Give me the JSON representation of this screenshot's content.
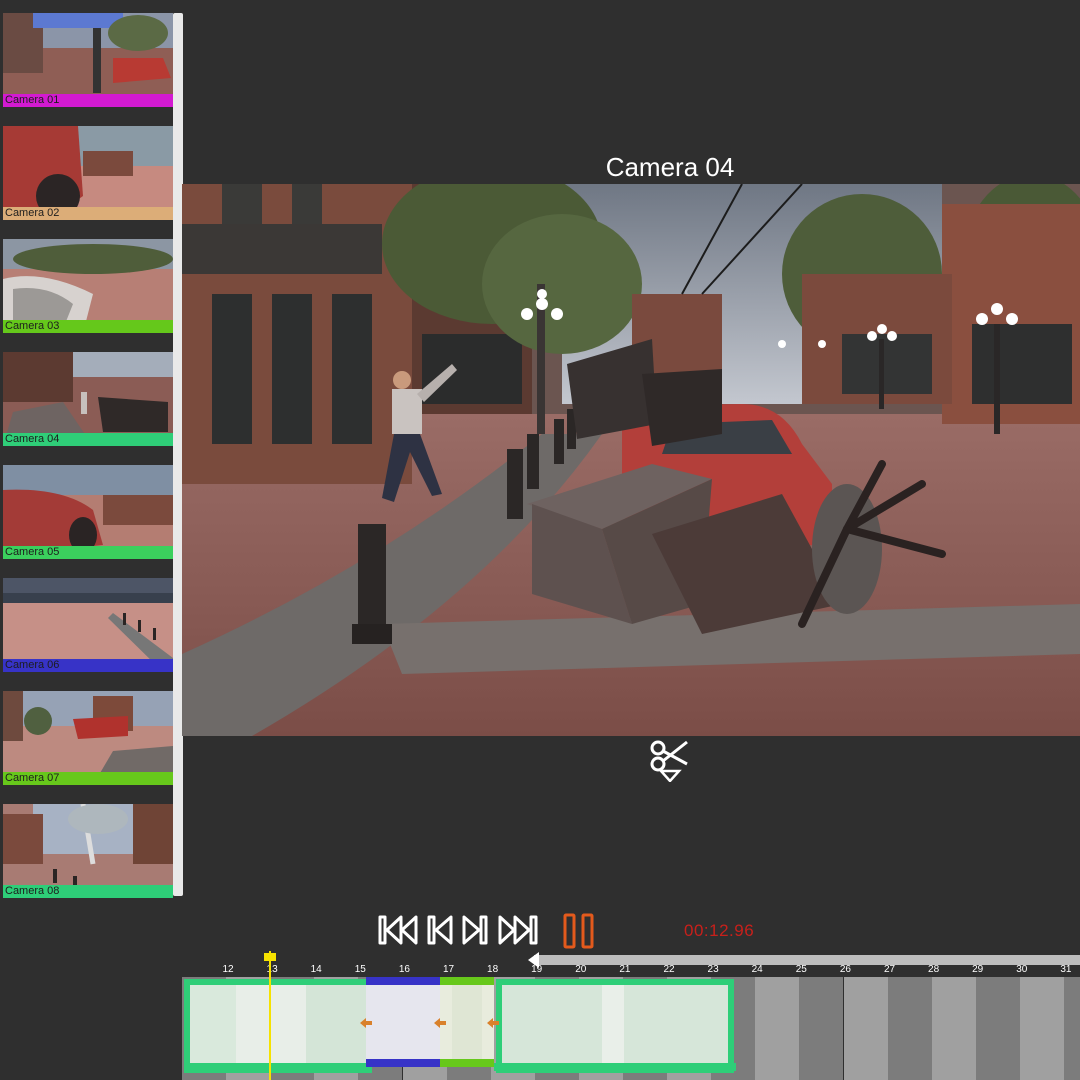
{
  "sidebar": {
    "cameras": [
      {
        "label": "Camera 01",
        "color": "#d31ad1",
        "scene": "street-car-red"
      },
      {
        "label": "Camera 02",
        "color": "#dcad78",
        "scene": "car-close"
      },
      {
        "label": "Camera 03",
        "color": "#65c81b",
        "scene": "car-mirror"
      },
      {
        "label": "Camera 04",
        "color": "#2fce78",
        "scene": "street-man"
      },
      {
        "label": "Camera 05",
        "color": "#3bd05d",
        "scene": "car-side"
      },
      {
        "label": "Camera 06",
        "color": "#3733c7",
        "scene": "plaza"
      },
      {
        "label": "Camera 07",
        "color": "#67c81b",
        "scene": "crash"
      },
      {
        "label": "Camera 08",
        "color": "#2ece78",
        "scene": "tree-street"
      }
    ]
  },
  "viewer": {
    "title": "Camera 04"
  },
  "icons": {
    "cut": "scissors-icon",
    "skip_start": "skip-to-start-icon",
    "step_back": "step-back-icon",
    "step_forward": "step-forward-icon",
    "skip_end": "skip-to-end-icon",
    "pause": "pause-icon"
  },
  "transport": {
    "timecode": "00:12.96",
    "pause_color": "#e35a1c",
    "icon_color": "#ffffff"
  },
  "timeline": {
    "ticks": [
      "12",
      "13",
      "14",
      "15",
      "16",
      "17",
      "18",
      "19",
      "20",
      "21",
      "22",
      "23",
      "24",
      "25",
      "26",
      "27",
      "28",
      "29",
      "30",
      "31"
    ],
    "playhead_color": "#f6e200",
    "clips": [
      {
        "camera": "Camera 04",
        "color": "#2fce78"
      },
      {
        "camera": "Camera 06",
        "color": "#3733c7"
      },
      {
        "camera": "Camera 07",
        "color": "#67c81b"
      },
      {
        "camera": "Camera 08",
        "color": "#2ece78"
      }
    ]
  }
}
